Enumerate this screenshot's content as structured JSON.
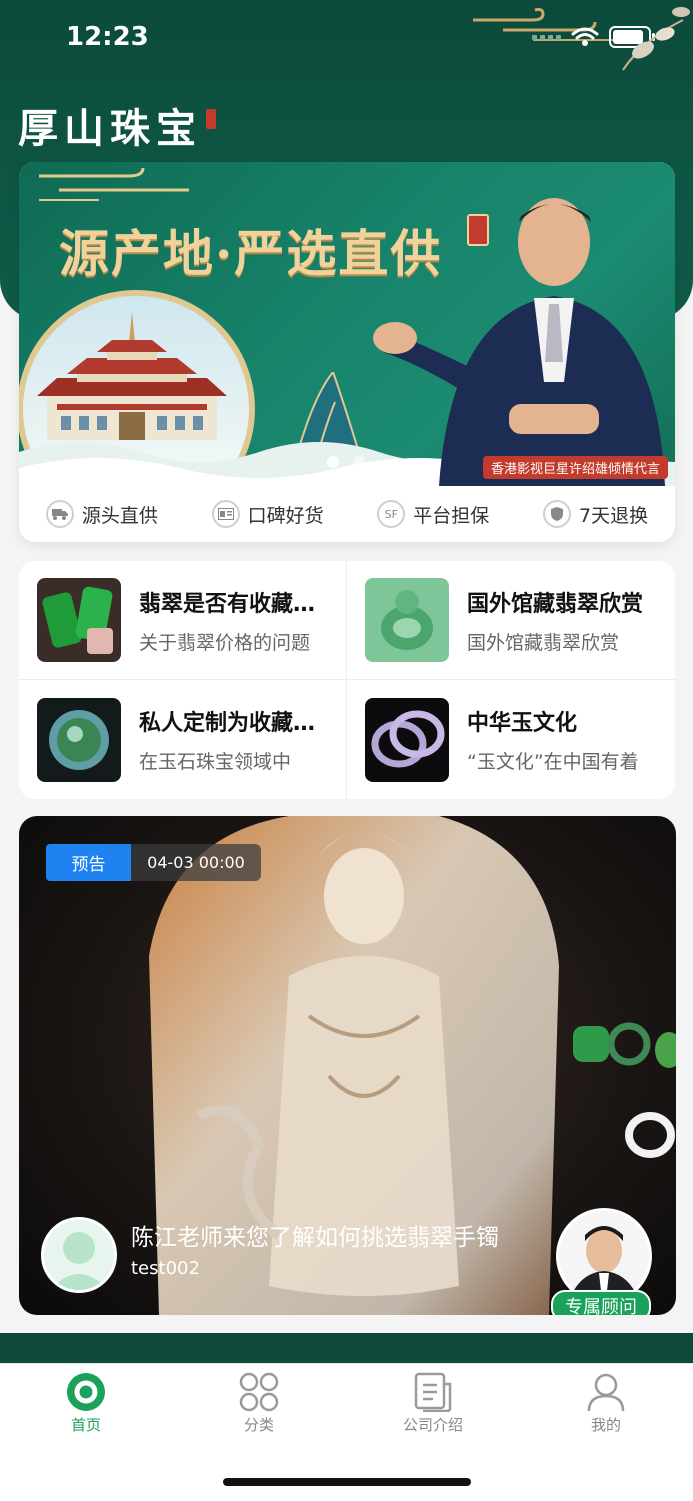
{
  "status_bar": {
    "time": "12:23"
  },
  "brand": {
    "name": "厚山珠宝"
  },
  "banner": {
    "title": "源产地·严选直供",
    "caption": "香港影视巨星许绍雄倾情代言",
    "slide_count": 2,
    "active_slide": 1
  },
  "features": [
    {
      "label": "源头直供",
      "icon": "truck-icon"
    },
    {
      "label": "口碑好货",
      "icon": "id-card-icon"
    },
    {
      "label": "平台担保",
      "icon": "sf-badge-icon"
    },
    {
      "label": "7天退换",
      "icon": "shield-icon"
    }
  ],
  "articles": [
    {
      "title": "翡翠是否有收藏价值",
      "desc": "关于翡翠价格的问题"
    },
    {
      "title": "国外馆藏翡翠欣赏",
      "desc": "国外馆藏翡翠欣赏"
    },
    {
      "title": "私人定制为收藏增值",
      "desc": "在玉石珠宝领域中"
    },
    {
      "title": "中华玉文化",
      "desc": "“玉文化”在中国有着"
    }
  ],
  "live": {
    "badge": "预告",
    "time": "04-03 00:00",
    "title": "陈江老师来您了解如何挑选翡翠手镯",
    "host": "test002",
    "advisor_label": "专属顾问"
  },
  "tabbar": {
    "items": [
      {
        "label": "首页",
        "icon": "home-icon",
        "active": true
      },
      {
        "label": "分类",
        "icon": "category-icon",
        "active": false
      },
      {
        "label": "公司介绍",
        "icon": "document-icon",
        "active": false
      },
      {
        "label": "我的",
        "icon": "profile-icon",
        "active": false
      }
    ]
  },
  "colors": {
    "brand_green": "#0e5544",
    "accent_green": "#1aa15a",
    "badge_blue": "#1e83f0",
    "seal_red": "#c23b2d",
    "gold": "#f0d39b"
  }
}
